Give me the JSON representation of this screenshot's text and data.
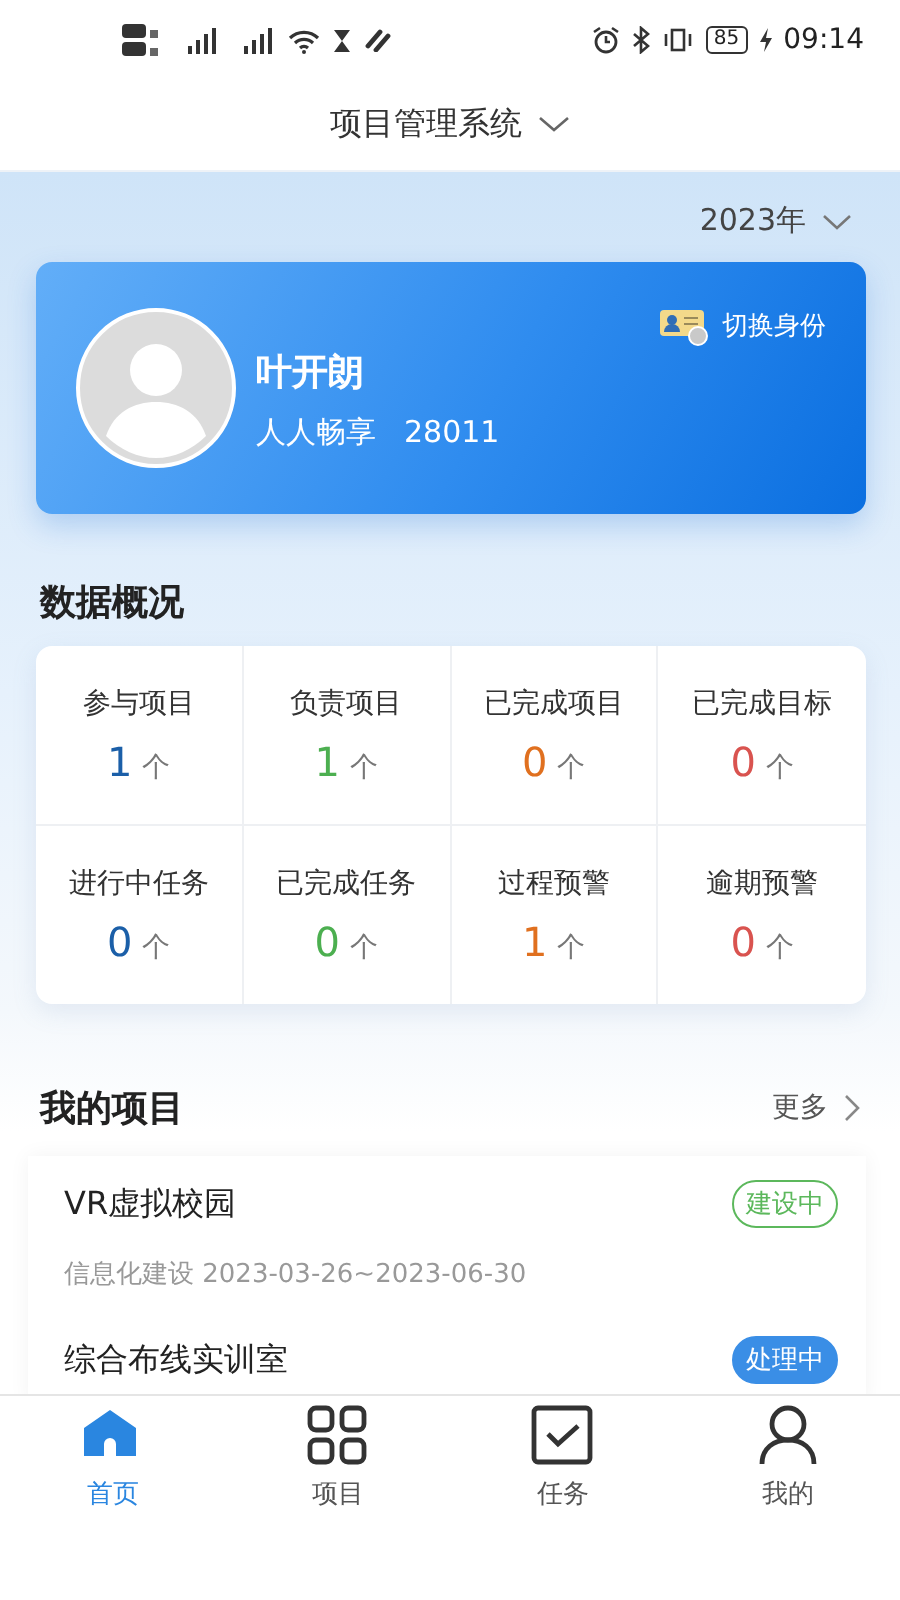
{
  "status_bar": {
    "time": "09:14",
    "battery": "85"
  },
  "header": {
    "title": "项目管理系统"
  },
  "year_picker": {
    "value": "2023年"
  },
  "user_card": {
    "name": "叶开朗",
    "organization": "人人畅享",
    "id": "28011",
    "switch_label": "切换身份"
  },
  "overview": {
    "title": "数据概况",
    "stats": [
      {
        "label": "参与项目",
        "value": "1",
        "unit": "个",
        "color": "#1b5fa8"
      },
      {
        "label": "负责项目",
        "value": "1",
        "unit": "个",
        "color": "#4caf50"
      },
      {
        "label": "已完成项目",
        "value": "0",
        "unit": "个",
        "color": "#e0701f"
      },
      {
        "label": "已完成目标",
        "value": "0",
        "unit": "个",
        "color": "#d9534f"
      },
      {
        "label": "进行中任务",
        "value": "0",
        "unit": "个",
        "color": "#1b5fa8"
      },
      {
        "label": "已完成任务",
        "value": "0",
        "unit": "个",
        "color": "#4caf50"
      },
      {
        "label": "过程预警",
        "value": "1",
        "unit": "个",
        "color": "#e0701f"
      },
      {
        "label": "逾期预警",
        "value": "0",
        "unit": "个",
        "color": "#d9534f"
      }
    ]
  },
  "my_projects": {
    "title": "我的项目",
    "more": "更多",
    "items": [
      {
        "name": "VR虚拟校园",
        "category": "信息化建设",
        "dates": "2023-03-26~2023-06-30",
        "status": "建设中",
        "kind": "outline",
        "color": "#5cb85c"
      },
      {
        "name": "综合布线实训室",
        "status": "处理中",
        "kind": "filled",
        "color": "#3a8ee6"
      }
    ]
  },
  "tab_bar": {
    "tabs": [
      {
        "label": "首页",
        "kind": "home",
        "selected": true
      },
      {
        "label": "项目",
        "kind": "grid",
        "selected": false
      },
      {
        "label": "任务",
        "kind": "check",
        "selected": false
      },
      {
        "label": "我的",
        "kind": "person",
        "selected": false
      }
    ]
  }
}
